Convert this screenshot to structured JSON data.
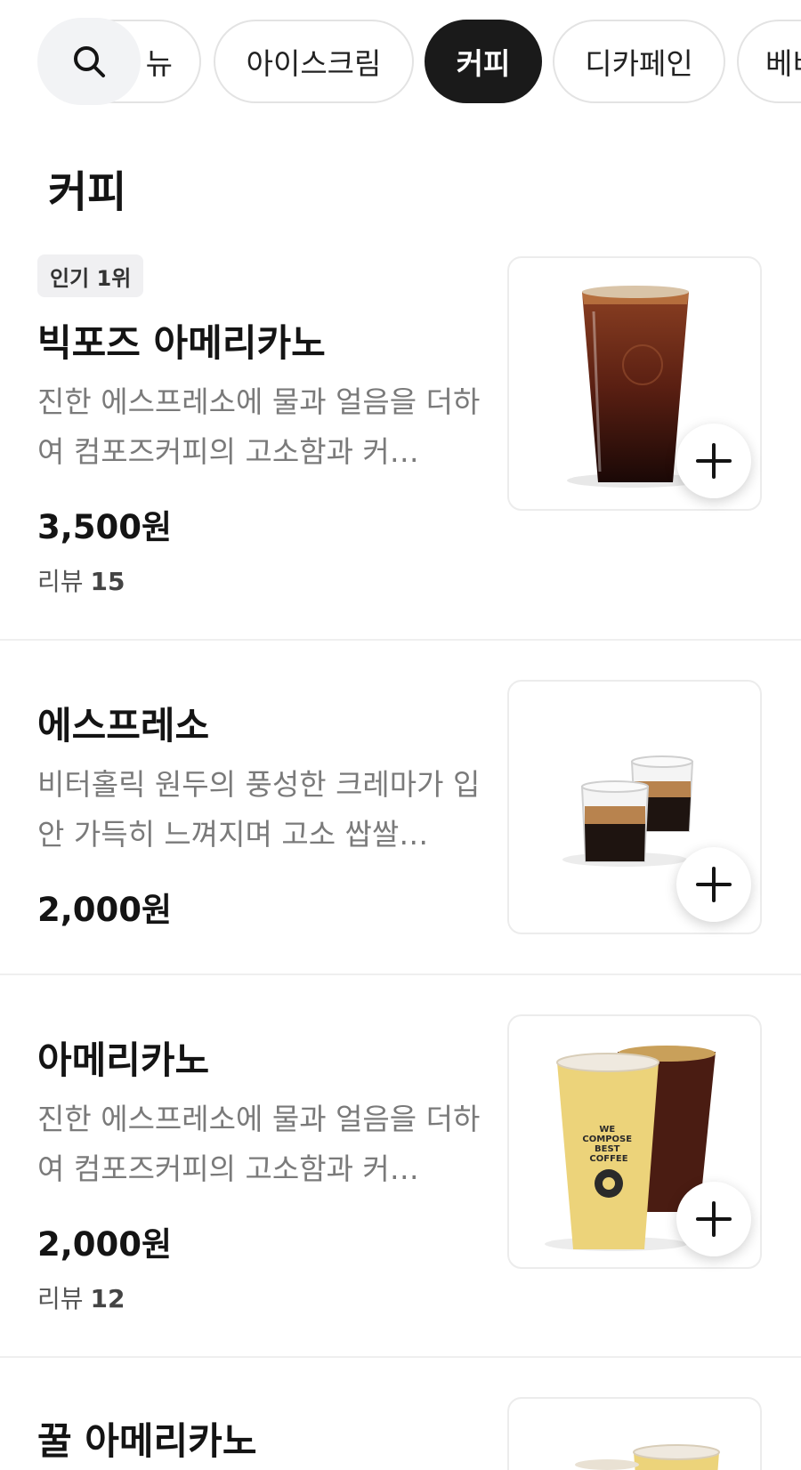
{
  "category_tabs": [
    {
      "label": "뉴"
    },
    {
      "label": "아이스크림"
    },
    {
      "label": "커피",
      "active": true
    },
    {
      "label": "디카페인"
    },
    {
      "label": "베비"
    }
  ],
  "section": {
    "title": "커피"
  },
  "items": [
    {
      "badge": "인기 1위",
      "name": "빅포즈 아메리카노",
      "description": "진한 에스프레소에 물과 얼음을 더하여 컴포즈커피의 고소함과 커…",
      "price": "3,500원",
      "review_label": "리뷰",
      "review_count": "15",
      "image_icon": "iced-americano-cup-icon"
    },
    {
      "name": "에스프레소",
      "description": "비터홀릭 원두의 풍성한 크레마가 입안 가득히 느껴지며 고소 쌉쌀…",
      "price": "2,000원",
      "image_icon": "espresso-glasses-icon"
    },
    {
      "name": "아메리카노",
      "description": "진한 에스프레소에 물과 얼음을 더하여 컴포즈커피의 고소함과 커…",
      "price": "2,000원",
      "review_label": "리뷰",
      "review_count": "12",
      "cup_text": "WE COMPOSE BEST COFFEE",
      "image_icon": "americano-cups-icon"
    },
    {
      "name": "꿀 아메리카노",
      "image_icon": "honey-americano-icon"
    }
  ],
  "colors": {
    "active_chip": "#1a1a1a",
    "price": "#141414",
    "description": "#7a7a7a",
    "cup_yellow": "#ecd37a"
  }
}
